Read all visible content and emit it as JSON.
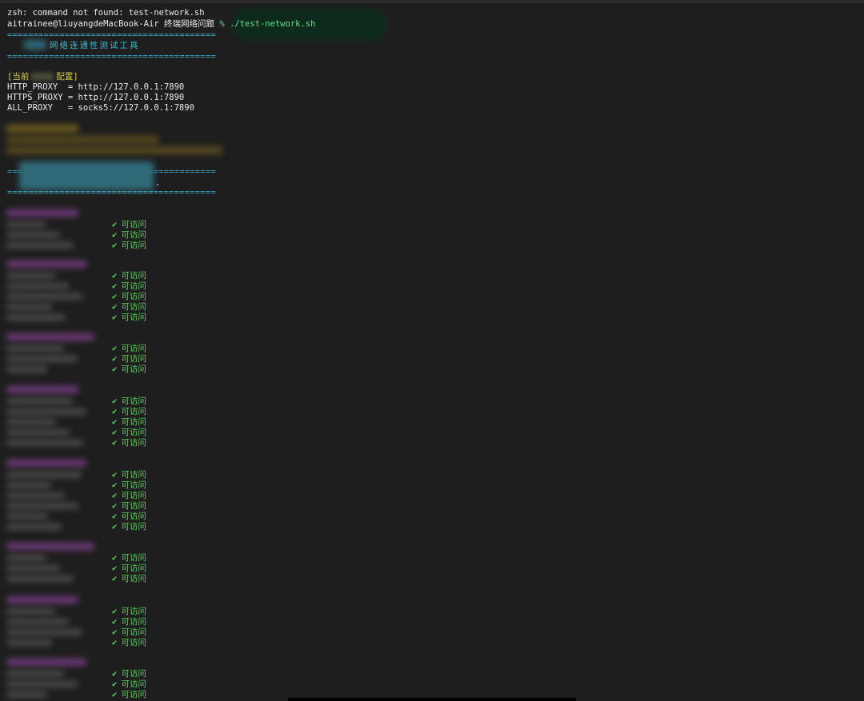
{
  "terminal": {
    "line1": "zsh: command not found: test-network.sh",
    "prompt_user": "aitrainee@liuyangdeMacBook-Air",
    "prompt_dir": "终端网络问题",
    "prompt_cmd": "% ./test-network.sh",
    "separator": "========================================",
    "tool_title": "网络连通性测试工具",
    "config_header_left": "[当前",
    "config_header_right": "配置]",
    "http_proxy": "HTTP_PROXY  = http://127.0.0.1:7890",
    "https_proxy": "HTTPS_PROXY = http://127.0.0.1:7890",
    "all_proxy": "ALL_PROXY   = socks5://127.0.0.1:7890",
    "dot": ".",
    "status_ok": "可访问",
    "check_mark": "✔"
  },
  "groups": [
    {
      "count": 3
    },
    {
      "count": 5
    },
    {
      "count": 3
    },
    {
      "count": 5
    },
    {
      "count": 6
    },
    {
      "count": 3
    },
    {
      "count": 4
    },
    {
      "count": 3
    }
  ],
  "colors": {
    "background": "#1e1e1e",
    "separator": "#3fa6c0",
    "config_header": "#d6c84a",
    "success": "#58d35a"
  }
}
